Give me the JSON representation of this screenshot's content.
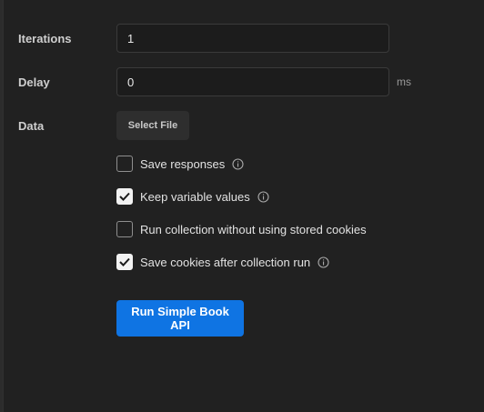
{
  "settings": {
    "iterations": {
      "label": "Iterations",
      "value": "1"
    },
    "delay": {
      "label": "Delay",
      "value": "0",
      "unit": "ms"
    },
    "data": {
      "label": "Data",
      "button_label": "Select File"
    }
  },
  "options": [
    {
      "label": "Save responses",
      "checked": false,
      "info_icon": "info-icon"
    },
    {
      "label": "Keep variable values",
      "checked": true,
      "info_icon": "info-icon"
    },
    {
      "label": "Run collection without using stored cookies",
      "checked": false
    },
    {
      "label": "Save cookies after collection run",
      "checked": true,
      "info_icon": "info-icon"
    }
  ],
  "run_button": {
    "label": "Run Simple Book API"
  },
  "colors": {
    "background": "#212121",
    "accent": "#0f74e3",
    "checkbox_checked": "#f2f2f2"
  }
}
